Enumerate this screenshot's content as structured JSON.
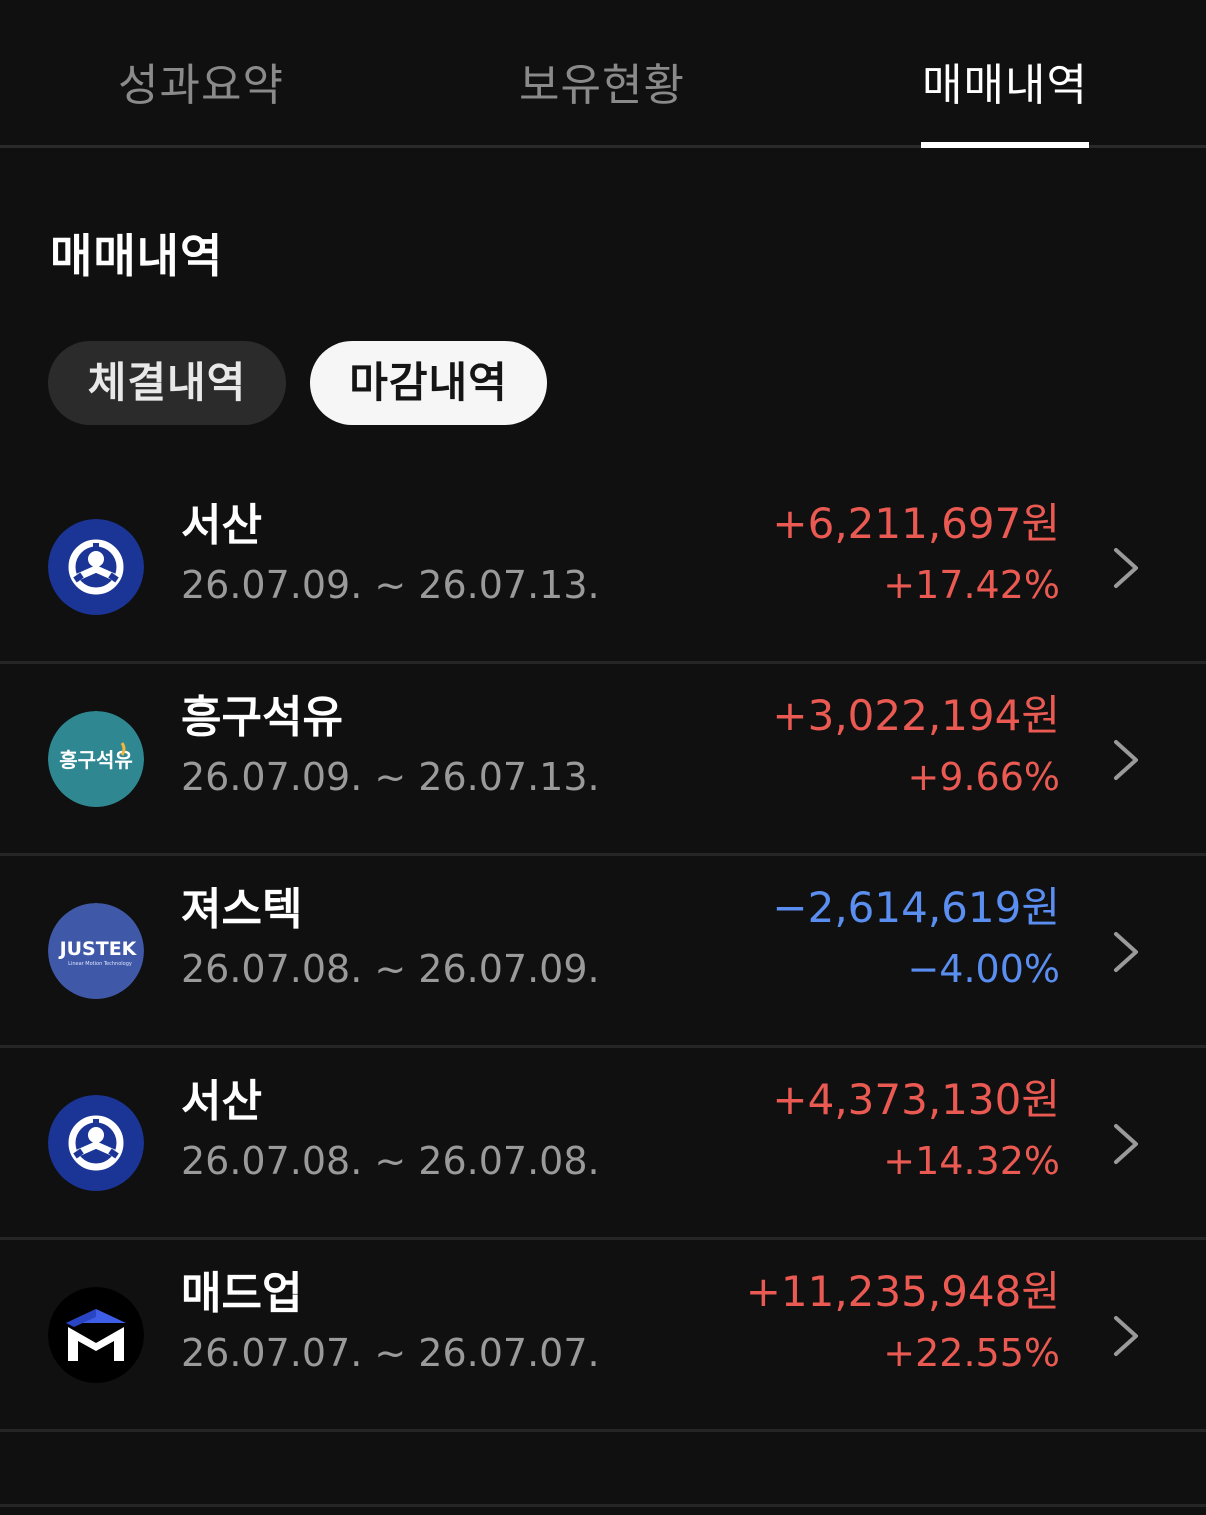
{
  "tabs": [
    {
      "label": "성과요약",
      "active": false
    },
    {
      "label": "보유현황",
      "active": false
    },
    {
      "label": "매매내역",
      "active": true
    }
  ],
  "section_title": "매매내역",
  "filters": [
    {
      "label": "체결내역",
      "selected": false
    },
    {
      "label": "마감내역",
      "selected": true
    }
  ],
  "colors": {
    "profit": "#ea5a52",
    "loss": "#5a8ef0"
  },
  "trades": [
    {
      "name": "서산",
      "period": "26.07.09. ~ 26.07.13.",
      "amount": "+6,211,697원",
      "percent": "+17.42%",
      "direction": "profit",
      "logo": "seosan-logo-icon"
    },
    {
      "name": "흥구석유",
      "period": "26.07.09. ~ 26.07.13.",
      "amount": "+3,022,194원",
      "percent": "+9.66%",
      "direction": "profit",
      "logo": "heunggu-logo-icon",
      "logo_text": "흥구석유"
    },
    {
      "name": "져스텍",
      "period": "26.07.08. ~ 26.07.09.",
      "amount": "−2,614,619원",
      "percent": "−4.00%",
      "direction": "loss",
      "logo": "justek-logo-icon",
      "logo_text": "JUSTEK",
      "logo_subtext": "Linear Motion Technology"
    },
    {
      "name": "서산",
      "period": "26.07.08. ~ 26.07.08.",
      "amount": "+4,373,130원",
      "percent": "+14.32%",
      "direction": "profit",
      "logo": "seosan-logo-icon"
    },
    {
      "name": "매드업",
      "period": "26.07.07. ~ 26.07.07.",
      "amount": "+11,235,948원",
      "percent": "+22.55%",
      "direction": "profit",
      "logo": "madup-logo-icon"
    }
  ]
}
